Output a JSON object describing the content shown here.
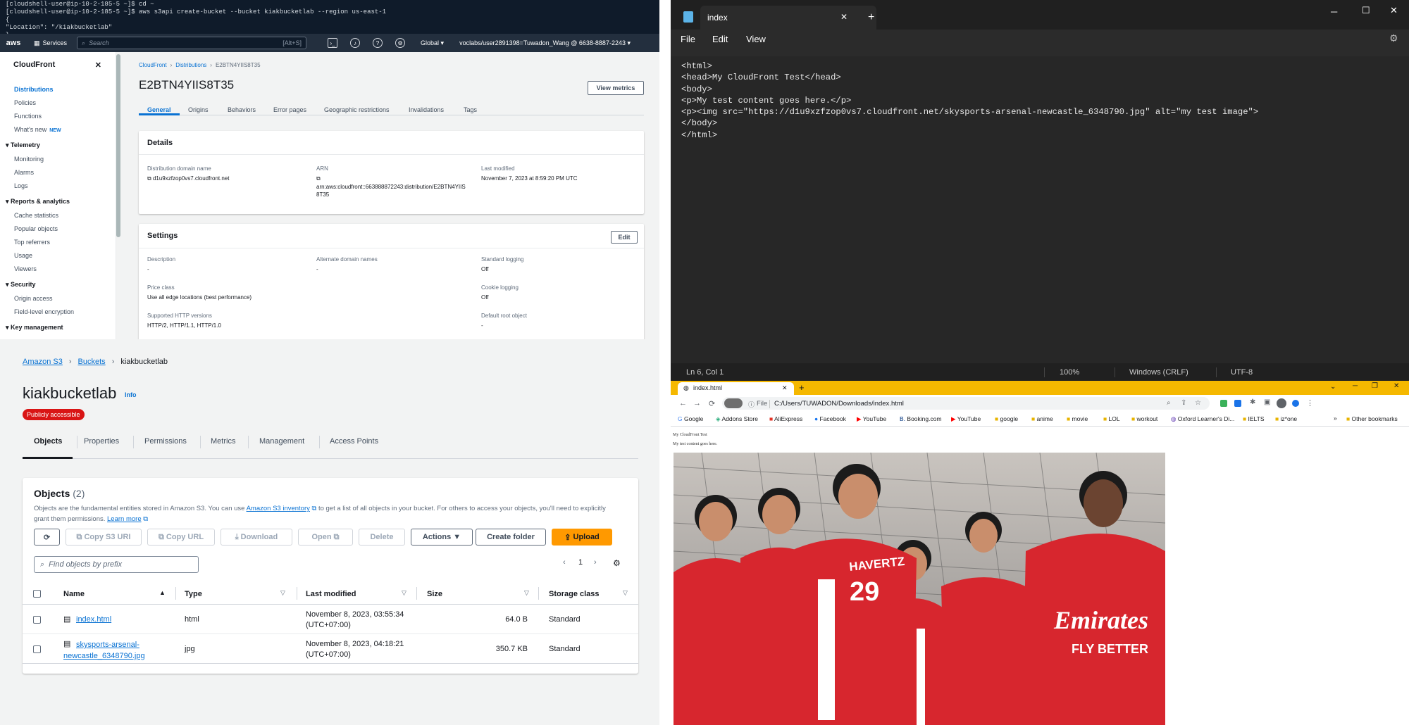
{
  "terminal": {
    "lines": [
      "[cloudshell-user@ip-10-2-185-5 ~]$ cd ~",
      "[cloudshell-user@ip-10-2-185-5 ~]$ aws s3api create-bucket --bucket kiakbucketlab --region us-east-1",
      "{",
      "    \"Location\": \"/kiakbucketlab\"",
      "}"
    ]
  },
  "aws_nav": {
    "logo": "aws",
    "services": "Services",
    "search_placeholder": "Search",
    "search_shortcut": "[Alt+S]",
    "region": "Global ▾",
    "account": "voclabs/user2891398=Tuwadon_Wang @ 6638-8887-2243 ▾"
  },
  "cloudfront": {
    "side_title": "CloudFront",
    "items_top": [
      "Distributions",
      "Policies",
      "Functions",
      "What's new"
    ],
    "new_badge": "NEW",
    "sections": [
      {
        "title": "Telemetry",
        "items": [
          "Monitoring",
          "Alarms",
          "Logs"
        ]
      },
      {
        "title": "Reports & analytics",
        "items": [
          "Cache statistics",
          "Popular objects",
          "Top referrers",
          "Usage",
          "Viewers"
        ]
      },
      {
        "title": "Security",
        "items": [
          "Origin access",
          "Field-level encryption"
        ]
      },
      {
        "title": "Key management",
        "items": []
      }
    ],
    "breadcrumb": [
      "CloudFront",
      "Distributions",
      "E2BTN4YIIS8T35"
    ],
    "title": "E2BTN4YIIS8T35",
    "view_metrics": "View metrics",
    "tabs": [
      "General",
      "Origins",
      "Behaviors",
      "Error pages",
      "Geographic restrictions",
      "Invalidations",
      "Tags"
    ],
    "details_title": "Details",
    "domain_label": "Distribution domain name",
    "domain_value": "d1u9xzfzop0vs7.cloudfront.net",
    "arn_label": "ARN",
    "arn_value": "arn:aws:cloudfront::663888872243:distribution/E2BTN4YIIS8T35",
    "modified_label": "Last modified",
    "modified_value": "November 7, 2023 at 8:59:20 PM UTC",
    "settings_title": "Settings",
    "edit": "Edit",
    "desc_label": "Description",
    "desc_value": "-",
    "alt_label": "Alternate domain names",
    "alt_value": "-",
    "std_label": "Standard logging",
    "std_value": "Off",
    "price_label": "Price class",
    "price_value": "Use all edge locations (best performance)",
    "cookie_label": "Cookie logging",
    "cookie_value": "Off",
    "http_label": "Supported HTTP versions",
    "http_value": "HTTP/2, HTTP/1.1, HTTP/1.0",
    "root_label": "Default root object",
    "root_value": "-"
  },
  "s3": {
    "breadcrumb": [
      "Amazon S3",
      "Buckets",
      "kiakbucketlab"
    ],
    "bucket": "kiakbucketlab",
    "info": "Info",
    "badge": "Publicly accessible",
    "tabs": [
      "Objects",
      "Properties",
      "Permissions",
      "Metrics",
      "Management",
      "Access Points"
    ],
    "objects_title": "Objects",
    "objects_count": "(2)",
    "desc1": "Objects are the fundamental entities stored in Amazon S3. You can use",
    "inventory_link": "Amazon S3 inventory",
    "desc2": "to get a list of all objects in your bucket. For others to access your objects, you'll need to explicitly",
    "desc3": "grant them permissions.",
    "learn_more": "Learn more",
    "buttons": {
      "copy_uri": "Copy S3 URI",
      "copy_url": "Copy URL",
      "download": "Download",
      "open": "Open",
      "delete": "Delete",
      "actions": "Actions ▼",
      "create_folder": "Create folder",
      "upload": "Upload"
    },
    "find_placeholder": "Find objects by prefix",
    "page": "1",
    "columns": [
      "Name",
      "Type",
      "Last modified",
      "Size",
      "Storage class"
    ],
    "rows": [
      {
        "name": "index.html",
        "type": "html",
        "modified": "November 8, 2023, 03:55:34",
        "tz": "(UTC+07:00)",
        "size": "64.0 B",
        "class": "Standard"
      },
      {
        "name": "skysports-arsenal-",
        "name2": "newcastle_6348790.jpg",
        "type": "jpg",
        "modified": "November 8, 2023, 04:18:21",
        "tz": "(UTC+07:00)",
        "size": "350.7 KB",
        "class": "Standard"
      }
    ]
  },
  "notepad": {
    "tab": "index",
    "menu": [
      "File",
      "Edit",
      "View"
    ],
    "code": [
      "<html>",
      "<head>My CloudFront Test</head>",
      "<body>",
      "<p>My test content goes here.</p>",
      "<p><img src=\"https://d1u9xzfzop0vs7.cloudfront.net/skysports-arsenal-newcastle_6348790.jpg\" alt=\"my test image\">",
      "</body>",
      "</html>"
    ],
    "status_pos": "Ln 6, Col 1",
    "zoom": "100%",
    "eol": "Windows (CRLF)",
    "encoding": "UTF-8"
  },
  "chrome": {
    "tab": "index.html",
    "file_label": "File",
    "url": "C:/Users/TUWADON/Downloads/index.html",
    "bookmarks": [
      "Google",
      "Addons Store",
      "AliExpress",
      "Facebook",
      "YouTube",
      "Booking.com",
      "YouTube",
      "google",
      "anime",
      "movie",
      "LOL",
      "workout",
      "Oxford Learner's Di...",
      "IELTS",
      "iz*one"
    ],
    "other_bookmarks": "Other bookmarks",
    "page_line1": "My CloudFront Test",
    "page_line2": "My test content goes here.",
    "jersey1": "HAVERTZ",
    "jersey_num": "29",
    "sponsor": "Emirates",
    "sponsor2": "FLY BETTER"
  },
  "colors": {
    "aws_nav": "#232f3e",
    "aws_link": "#0972d3",
    "s3_upload": "#ff9900",
    "badge": "#d91515",
    "chrome_tabbar": "#f5b800",
    "notepad_bg": "#272727"
  }
}
